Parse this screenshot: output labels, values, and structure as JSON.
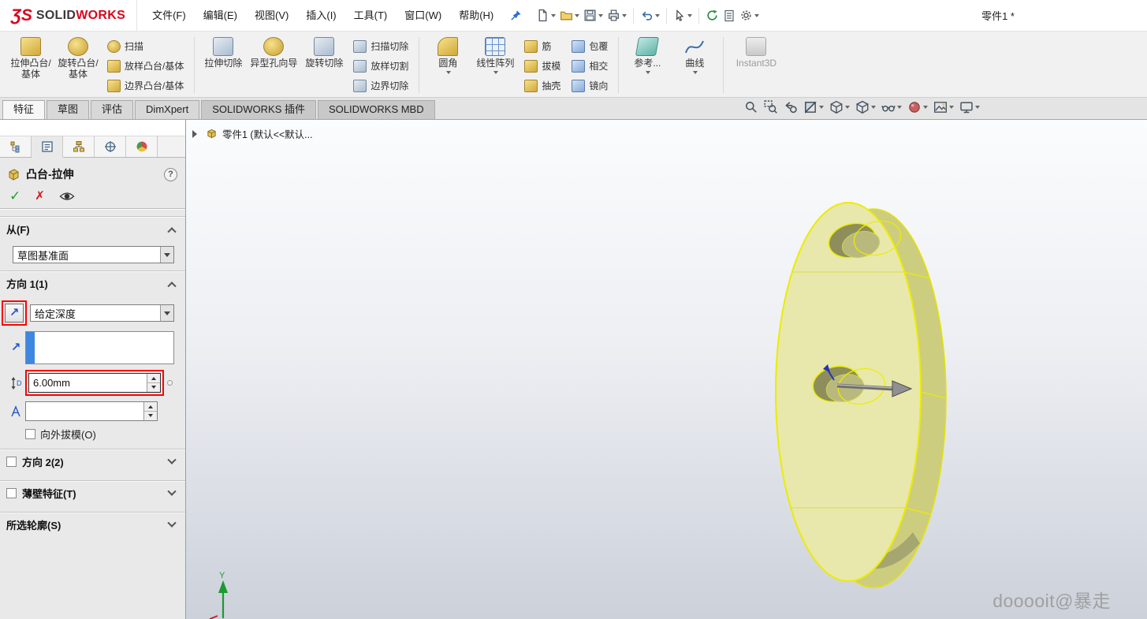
{
  "window": {
    "brand_glyph": "ƷS",
    "brand_solid": "SOLID",
    "brand_works": "WORKS",
    "doc_title": "零件1 *"
  },
  "menus": {
    "file": "文件(F)",
    "edit": "编辑(E)",
    "view": "视图(V)",
    "insert": "插入(I)",
    "tools": "工具(T)",
    "window": "窗口(W)",
    "help": "帮助(H)"
  },
  "quick_toolbar": {
    "icons": [
      "new-document",
      "open-folder",
      "save",
      "print",
      "undo",
      "select-cursor",
      "rebuild",
      "file-properties",
      "options-gear"
    ]
  },
  "ribbon": {
    "features_group": {
      "extrude_boss": "拉伸凸台/基体",
      "revolve_boss": "旋转凸台/基体",
      "swept_boss": "扫描",
      "lofted_boss": "放样凸台/基体",
      "boundary_boss": "边界凸台/基体",
      "extruded_cut": "拉伸切除",
      "hole_wizard": "异型孔向导",
      "revolved_cut": "旋转切除",
      "swept_cut": "扫描切除",
      "lofted_cut": "放样切割",
      "boundary_cut": "边界切除",
      "fillet": "圆角",
      "linear_pattern": "线性阵列",
      "rib": "筋",
      "draft": "拔模",
      "shell": "抽壳",
      "wrap": "包覆",
      "intersect": "相交",
      "mirror": "镜向",
      "reference": "参考...",
      "curves": "曲线",
      "instant3d": "Instant3D"
    }
  },
  "tabs": {
    "t0": "特征",
    "t1": "草图",
    "t2": "评估",
    "t3": "DimXpert",
    "t4": "SOLIDWORKS 插件",
    "t5": "SOLIDWORKS MBD"
  },
  "view_toolbar": {
    "icons": [
      "zoom-to-fit",
      "zoom-to-area",
      "previous-view",
      "section-view",
      "view-orientation",
      "display-style",
      "hide-show-items",
      "edit-appearance",
      "apply-scene",
      "view-settings"
    ]
  },
  "feature_tree": {
    "flyout_item": "零件1 (默认<<默认..."
  },
  "property_manager": {
    "title": "凸台-拉伸",
    "help": "?",
    "from_header": "从(F)",
    "from_value": "草图基准面",
    "dir1_header": "方向 1(1)",
    "dir1_end_condition": "给定深度",
    "dir1_depth": "6.00mm",
    "dir1_draft_outward": "向外拔模(O)",
    "dir2_header": "方向 2(2)",
    "thin_header": "薄壁特征(T)",
    "contours_header": "所选轮廓(S)"
  },
  "viewport": {
    "watermark": "dooooit@暴走",
    "triad_y": "Y"
  },
  "colors": {
    "brand_red": "#d6081c",
    "annotation_red": "#ff0000",
    "selection_blue": "#3d87e0",
    "preview_face": "#e8e8ac",
    "preview_edge": "#ecec00"
  }
}
